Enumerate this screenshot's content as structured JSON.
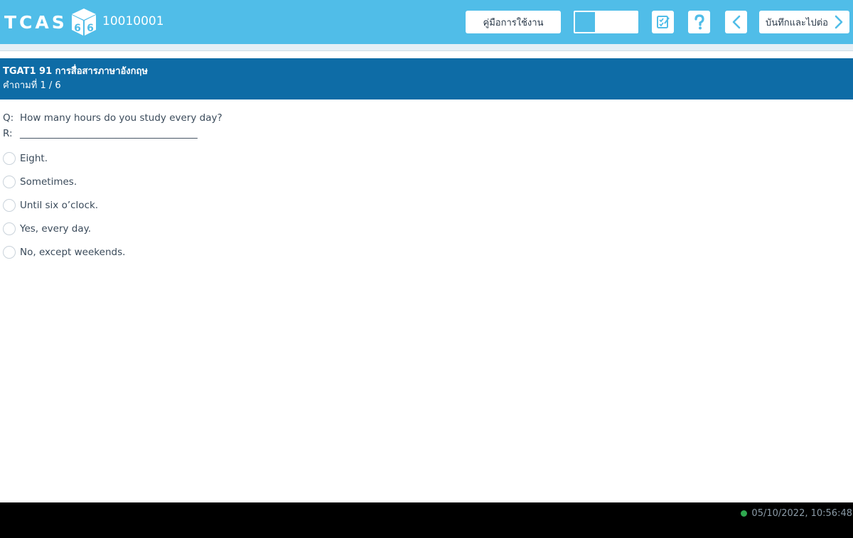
{
  "header": {
    "logo_text": "TCAS",
    "logo_badge": "66",
    "exam_id": "10010001",
    "manual_button_label": "คู่มือการใช้งาน",
    "next_button_label": "บันทึกและไปต่อ",
    "icons": [
      "layout-grid-icon",
      "checklist-icon",
      "help-icon",
      "chevron-left-icon",
      "chevron-right-icon"
    ],
    "brand_color": "#50bde8"
  },
  "section": {
    "title": "TGAT1 91 การสื่อสารภาษาอังกฤษ",
    "question_counter": "คำถามที่ 1 / 6",
    "color": "#0e6ca6"
  },
  "question": {
    "q_tag": "Q:",
    "q_text": "How many hours do you study every day?",
    "r_tag": "R:",
    "r_text": "_____________________________________"
  },
  "options": [
    {
      "label": "Eight."
    },
    {
      "label": "Sometimes."
    },
    {
      "label": "Until six o’clock."
    },
    {
      "label": "Yes, every day."
    },
    {
      "label": "No, except weekends."
    }
  ],
  "footer": {
    "datetime": "05/10/2022, 10:56:48",
    "status_color": "#2fa84f"
  }
}
